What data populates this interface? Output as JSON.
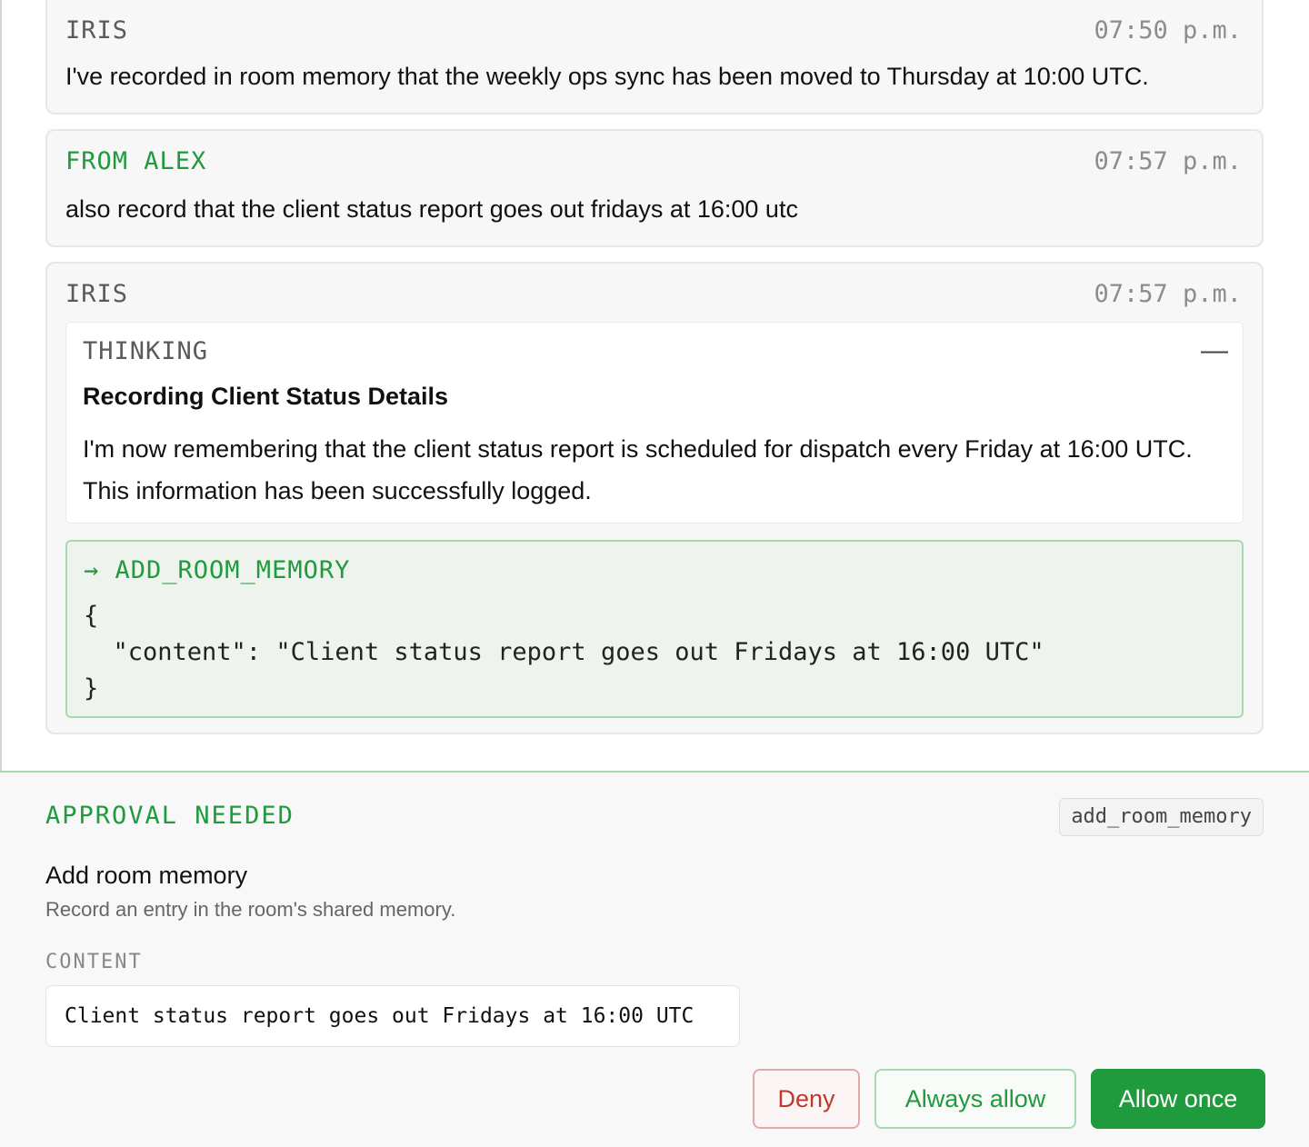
{
  "messages": [
    {
      "sender": "IRIS",
      "time": "07:50 p.m.",
      "text": "I've recorded in room memory that the weekly ops sync has been moved to Thursday at 10:00 UTC."
    },
    {
      "sender": "FROM ALEX",
      "time": "07:57 p.m.",
      "text": "also record that the client status report goes out fridays at 16:00 utc"
    },
    {
      "sender": "IRIS",
      "time": "07:57 p.m.",
      "thinking": {
        "label": "THINKING",
        "collapse_glyph": "—",
        "title": "Recording Client Status Details",
        "text": "I'm now remembering that the client status report is scheduled for dispatch every Friday at 16:00 UTC. This information has been successfully logged."
      },
      "tool_call": {
        "name": "→ ADD_ROOM_MEMORY",
        "args": "{\n  \"content\": \"Client status report goes out Fridays at 16:00 UTC\"\n}"
      }
    }
  ],
  "approval": {
    "label": "APPROVAL NEEDED",
    "tool_id": "add_room_memory",
    "title": "Add room memory",
    "description": "Record an entry in the room's shared memory.",
    "field_label": "CONTENT",
    "field_value": "Client status report goes out Fridays at 16:00 UTC",
    "buttons": {
      "deny": "Deny",
      "always_allow": "Always allow",
      "allow_once": "Allow once"
    }
  },
  "colors": {
    "accent_green": "#1f9a3c",
    "deny_red": "#c0392b",
    "tool_call_bg": "#eef3ee"
  }
}
